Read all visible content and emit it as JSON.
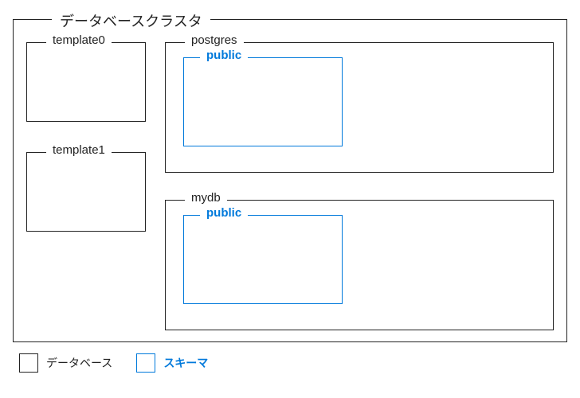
{
  "cluster": {
    "title": "データベースクラスタ"
  },
  "databases": {
    "template0": {
      "label": "template0"
    },
    "template1": {
      "label": "template1"
    },
    "postgres": {
      "label": "postgres",
      "schema": {
        "label": "public"
      }
    },
    "mydb": {
      "label": "mydb",
      "schema": {
        "label": "public"
      }
    }
  },
  "legend": {
    "database": "データベース",
    "schema": "スキーマ"
  }
}
